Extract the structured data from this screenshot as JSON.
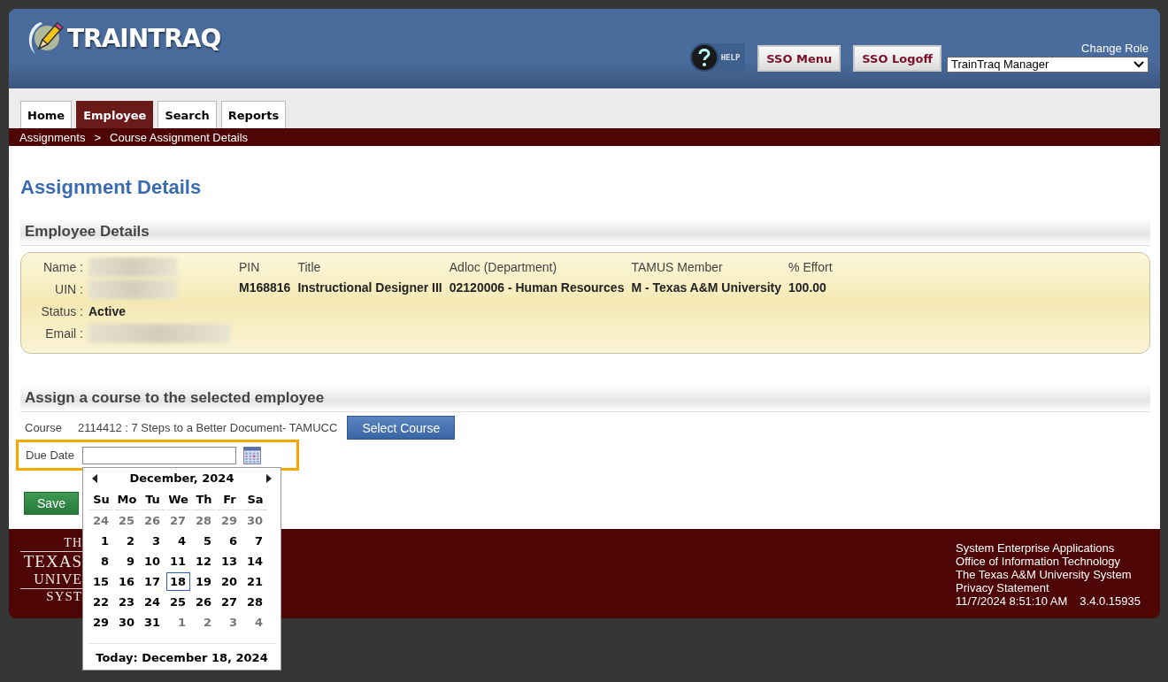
{
  "header": {
    "logo": "TRAINTRAQ",
    "help": "HELP",
    "buttons": [
      "SSO Menu",
      "SSO Logoff"
    ],
    "role_label": "Change Role",
    "role": "TrainTraq Manager"
  },
  "tabs": [
    {
      "label": "Home",
      "selected": false
    },
    {
      "label": "Employee",
      "selected": true
    },
    {
      "label": "Search",
      "selected": false
    },
    {
      "label": "Reports",
      "selected": false
    }
  ],
  "breadcrumb": [
    "Assignments",
    ">",
    "Course Assignment Details"
  ],
  "page_title": "Assignment Details",
  "employee_section": {
    "title": "Employee Details",
    "fields": [
      {
        "label": "Name :",
        "redacted": true
      },
      {
        "label": "UIN :",
        "redacted": true
      },
      {
        "label": "Status :",
        "value": "Active",
        "redacted": false
      },
      {
        "label": "Email :",
        "redacted": true
      }
    ],
    "columns": [
      {
        "header": "PIN",
        "value": "M168816"
      },
      {
        "header": "Title",
        "value": "Instructional Designer III"
      },
      {
        "header": "Adloc (Department)",
        "value": "02120006 - Human Resources"
      },
      {
        "header": "TAMUS Member",
        "value": "M - Texas A&M University"
      },
      {
        "header": "% Effort",
        "value": "100.00"
      }
    ]
  },
  "assign_section": {
    "title": "Assign a course to the selected employee",
    "course_label": "Course",
    "course_value": "2114412 : 7 Steps to a Better Document- TAMUCC",
    "select_button": "Select Course",
    "due_label": "Due Date",
    "highlighted": true
  },
  "save": "Save",
  "calendar": {
    "month": "December, 2024",
    "weekdays": [
      "Su",
      "Mo",
      "Tu",
      "We",
      "Th",
      "Fr",
      "Sa"
    ],
    "weeks": [
      [
        {
          "day": "24",
          "muted": true,
          "selected": false
        },
        {
          "day": "25",
          "muted": true,
          "selected": false
        },
        {
          "day": "26",
          "muted": true,
          "selected": false
        },
        {
          "day": "27",
          "muted": true,
          "selected": false
        },
        {
          "day": "28",
          "muted": true,
          "selected": false
        },
        {
          "day": "29",
          "muted": true,
          "selected": false
        },
        {
          "day": "30",
          "muted": true,
          "selected": false
        }
      ],
      [
        {
          "day": "1",
          "muted": false,
          "selected": false
        },
        {
          "day": "2",
          "muted": false,
          "selected": false
        },
        {
          "day": "3",
          "muted": false,
          "selected": false
        },
        {
          "day": "4",
          "muted": false,
          "selected": false
        },
        {
          "day": "5",
          "muted": false,
          "selected": false
        },
        {
          "day": "6",
          "muted": false,
          "selected": false
        },
        {
          "day": "7",
          "muted": false,
          "selected": false
        }
      ],
      [
        {
          "day": "8",
          "muted": false,
          "selected": false
        },
        {
          "day": "9",
          "muted": false,
          "selected": false
        },
        {
          "day": "10",
          "muted": false,
          "selected": false
        },
        {
          "day": "11",
          "muted": false,
          "selected": false
        },
        {
          "day": "12",
          "muted": false,
          "selected": false
        },
        {
          "day": "13",
          "muted": false,
          "selected": false
        },
        {
          "day": "14",
          "muted": false,
          "selected": false
        }
      ],
      [
        {
          "day": "15",
          "muted": false,
          "selected": false
        },
        {
          "day": "16",
          "muted": false,
          "selected": false
        },
        {
          "day": "17",
          "muted": false,
          "selected": false
        },
        {
          "day": "18",
          "muted": false,
          "selected": true
        },
        {
          "day": "19",
          "muted": false,
          "selected": false
        },
        {
          "day": "20",
          "muted": false,
          "selected": false
        },
        {
          "day": "21",
          "muted": false,
          "selected": false
        }
      ],
      [
        {
          "day": "22",
          "muted": false,
          "selected": false
        },
        {
          "day": "23",
          "muted": false,
          "selected": false
        },
        {
          "day": "24",
          "muted": false,
          "selected": false
        },
        {
          "day": "25",
          "muted": false,
          "selected": false
        },
        {
          "day": "26",
          "muted": false,
          "selected": false
        },
        {
          "day": "27",
          "muted": false,
          "selected": false
        },
        {
          "day": "28",
          "muted": false,
          "selected": false
        }
      ],
      [
        {
          "day": "29",
          "muted": false,
          "selected": false
        },
        {
          "day": "30",
          "muted": false,
          "selected": false
        },
        {
          "day": "31",
          "muted": false,
          "selected": false
        },
        {
          "day": "1",
          "muted": true,
          "selected": false
        },
        {
          "day": "2",
          "muted": true,
          "selected": false
        },
        {
          "day": "3",
          "muted": true,
          "selected": false
        },
        {
          "day": "4",
          "muted": true,
          "selected": false
        }
      ]
    ],
    "today": "Today: December 18, 2024"
  },
  "footer": {
    "logo_lines": [
      "TH",
      "TEXAS",
      "UNIVE",
      "SYST"
    ],
    "lines": [
      "System Enterprise Applications",
      "Office of Information Technology",
      "The Texas A&M University System"
    ],
    "privacy_link": "Privacy Statement",
    "timestamp": "11/7/2024 8:51:10 AM",
    "version": "3.4.0.15935"
  }
}
